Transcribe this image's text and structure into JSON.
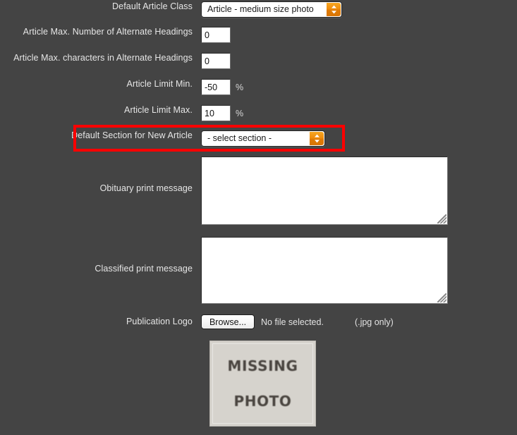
{
  "theme": {
    "background": "#444444",
    "accent_orange": "#ef8b0b",
    "highlight_red": "#ff0000",
    "field_background": "#ffffff",
    "label_color": "#e6e6e6"
  },
  "form": {
    "rows": [
      {
        "label": "Default Article Class",
        "type": "select",
        "value": "Article - medium size photo"
      },
      {
        "label": "Article Max. Number of Alternate Headings",
        "type": "text",
        "value": "0"
      },
      {
        "label": "Article Max. characters in Alternate Headings",
        "type": "text",
        "value": "0"
      },
      {
        "label": "Article Limit Min.",
        "type": "text",
        "value": "-50",
        "suffix": "%"
      },
      {
        "label": "Article Limit Max.",
        "type": "text",
        "value": "10",
        "suffix": "%"
      },
      {
        "label": "Default Section for New Article",
        "type": "select",
        "value": "- select section -",
        "highlighted": true
      },
      {
        "label": "Obituary print message",
        "type": "textarea",
        "value": ""
      },
      {
        "label": "Classified print message",
        "type": "textarea",
        "value": ""
      },
      {
        "label": "Publication Logo",
        "type": "file",
        "button_label": "Browse...",
        "status": "No file selected.",
        "note": "(.jpg only)"
      }
    ]
  },
  "preview_image": {
    "line1": "MISSING",
    "line2": "PHOTO",
    "alt": "missing-photo-placeholder"
  },
  "icons": {
    "select_chevrons": "chevron-up-down-icon",
    "resize_grip": "resize-grip-icon"
  }
}
